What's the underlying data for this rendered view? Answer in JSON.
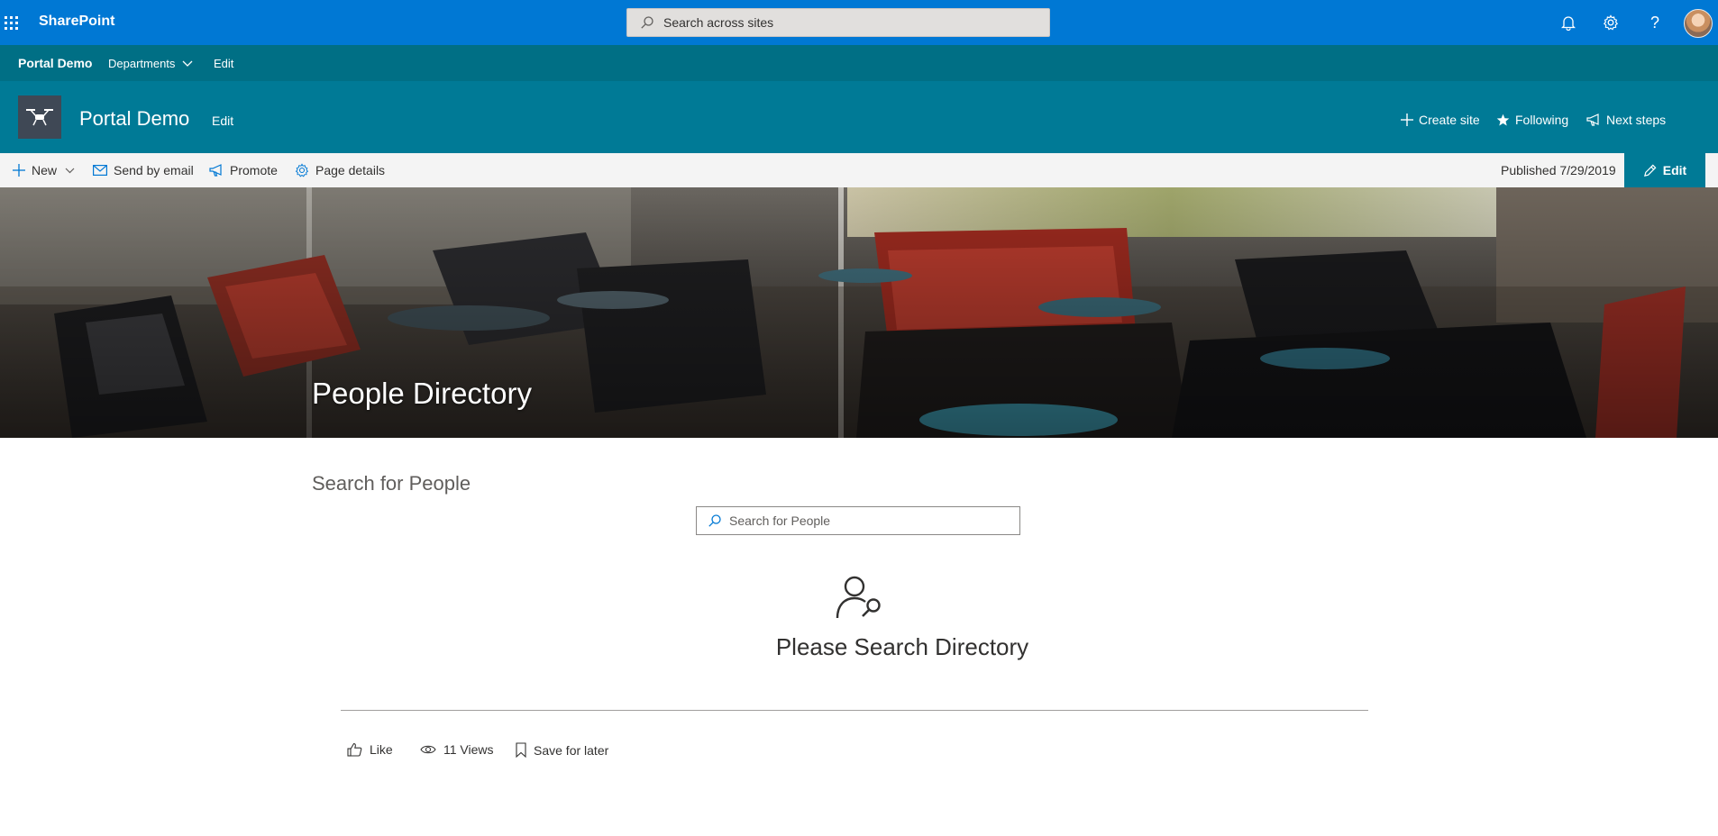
{
  "suite_bar": {
    "app_name": "SharePoint",
    "search_placeholder": "Search across sites",
    "icons": [
      "app-launcher-icon",
      "bell-icon",
      "gear-icon",
      "help-icon"
    ],
    "accent_color": "#0078d4"
  },
  "hub_nav": {
    "title": "Portal Demo",
    "items": [
      {
        "label": "Departments"
      },
      {
        "label": "Edit"
      }
    ],
    "color": "#006f85"
  },
  "site_header": {
    "title": "Portal Demo",
    "edit_label": "Edit",
    "actions": [
      {
        "label": "Create site",
        "icon": "plus-icon"
      },
      {
        "label": "Following",
        "icon": "star-icon"
      },
      {
        "label": "Next steps",
        "icon": "megaphone-icon"
      }
    ],
    "color": "#007a96"
  },
  "command_bar": {
    "items": [
      {
        "label": "New",
        "icon": "plus-icon"
      },
      {
        "label": "Send by email",
        "icon": "mail-icon"
      },
      {
        "label": "Promote",
        "icon": "megaphone-icon"
      },
      {
        "label": "Page details",
        "icon": "gear-icon"
      }
    ],
    "published": "Published 7/29/2019",
    "edit_label": "Edit"
  },
  "hero": {
    "title": "People Directory"
  },
  "content": {
    "section_title": "Search for People",
    "search_placeholder": "Search for People",
    "empty_message": "Please Search Directory"
  },
  "footer": {
    "like": "Like",
    "views": "11 Views",
    "save": "Save for later"
  }
}
